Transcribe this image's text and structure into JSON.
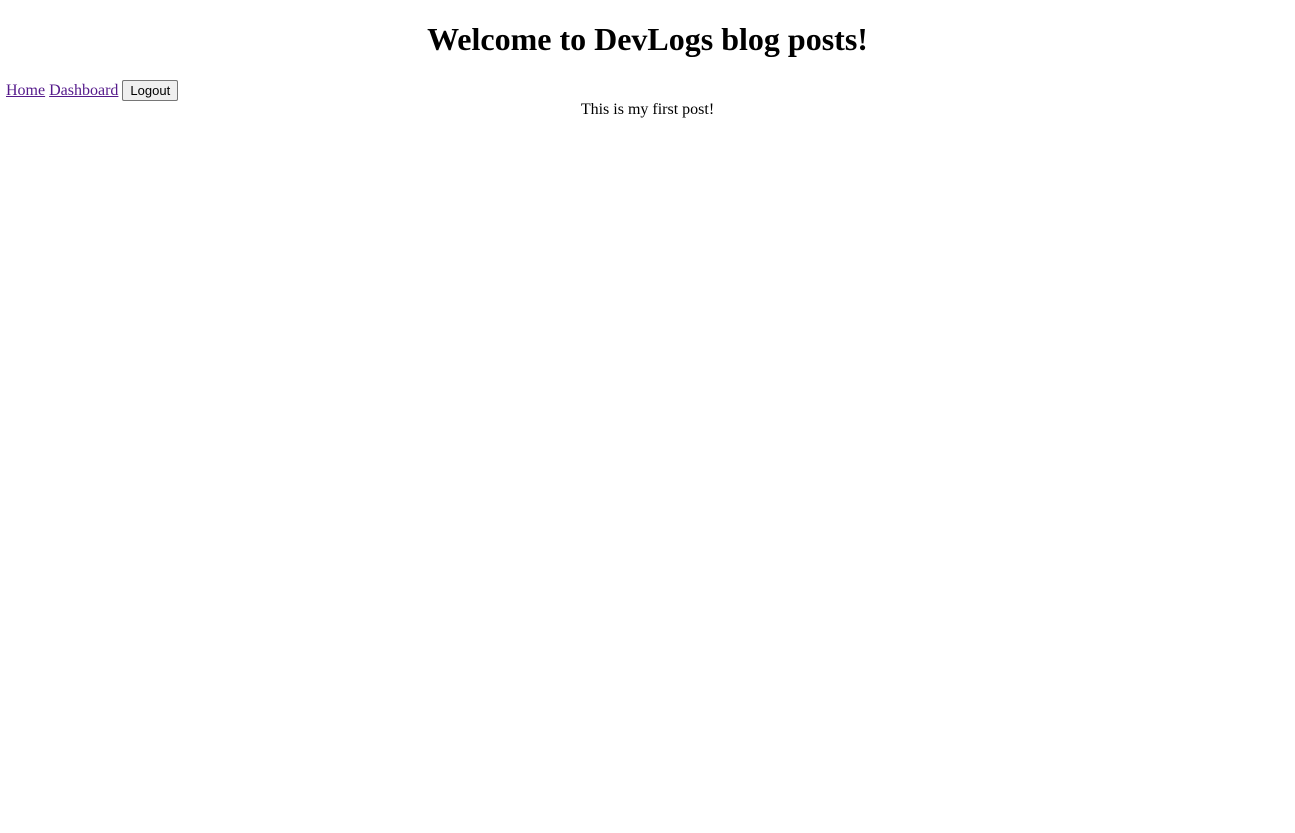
{
  "header": {
    "title": "Welcome to DevLogs blog posts!"
  },
  "nav": {
    "home_label": "Home",
    "dashboard_label": "Dashboard",
    "logout_label": "Logout",
    "link_color": "#551a8b"
  },
  "posts": [
    {
      "text": "This is my first post!"
    }
  ]
}
